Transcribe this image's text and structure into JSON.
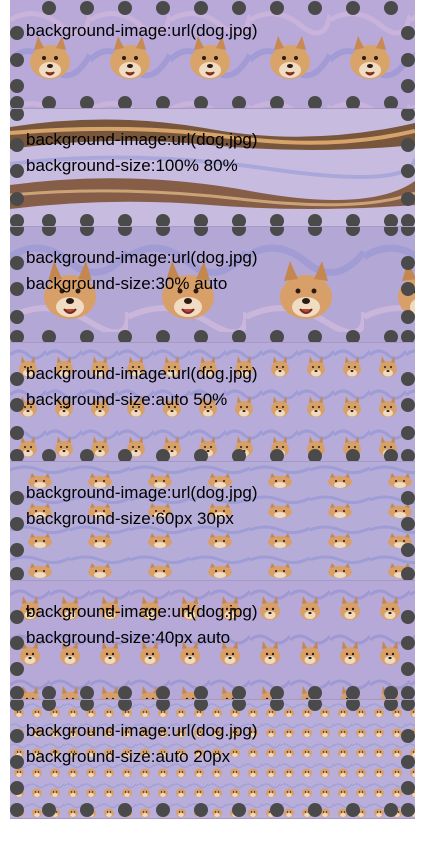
{
  "panels": [
    {
      "id": "p1",
      "line1": "background-image:url(dog.jpg)",
      "line2": "",
      "tile": "large-dog",
      "colors": {
        "base": "#b8a9d8",
        "accent": "#8d8fd0"
      }
    },
    {
      "id": "p2",
      "line1": "background-image:url(dog.jpg)",
      "line2": "background-size:100% 80%",
      "tile": "stretched-wide",
      "colors": {
        "base": "#c7bce0",
        "accent": "#6f4a2a"
      }
    },
    {
      "id": "p3",
      "line1": "background-image:url(dog.jpg)",
      "line2": "background-size:30% auto",
      "tile": "medium-dog",
      "colors": {
        "base": "#b3a7d5",
        "accent": "#8f93d3"
      }
    },
    {
      "id": "p4",
      "line1": "background-image:url(dog.jpg)",
      "line2": "background-size:auto 50%",
      "tile": "small-dog",
      "colors": {
        "base": "#b7acd9",
        "accent": "#8d91d2"
      }
    },
    {
      "id": "p5",
      "line1": "background-image:url(dog.jpg)",
      "line2": "background-size:60px 30px",
      "tile": "tiny-dog",
      "colors": {
        "base": "#b6acd8",
        "accent": "#8f93d5"
      }
    },
    {
      "id": "p6",
      "line1": "background-image:url(dog.jpg)",
      "line2": "background-size:40px auto",
      "tile": "small-dog-2",
      "colors": {
        "base": "#b6a8d7",
        "accent": "#8d90d1"
      }
    },
    {
      "id": "p7",
      "line1": "background-image:url(dog.jpg)",
      "line2": "background-size:auto 20px",
      "tile": "micro-dog",
      "colors": {
        "base": "#b9aed9",
        "accent": "#9297d5"
      }
    }
  ],
  "dot_color": "#4a4a4a"
}
